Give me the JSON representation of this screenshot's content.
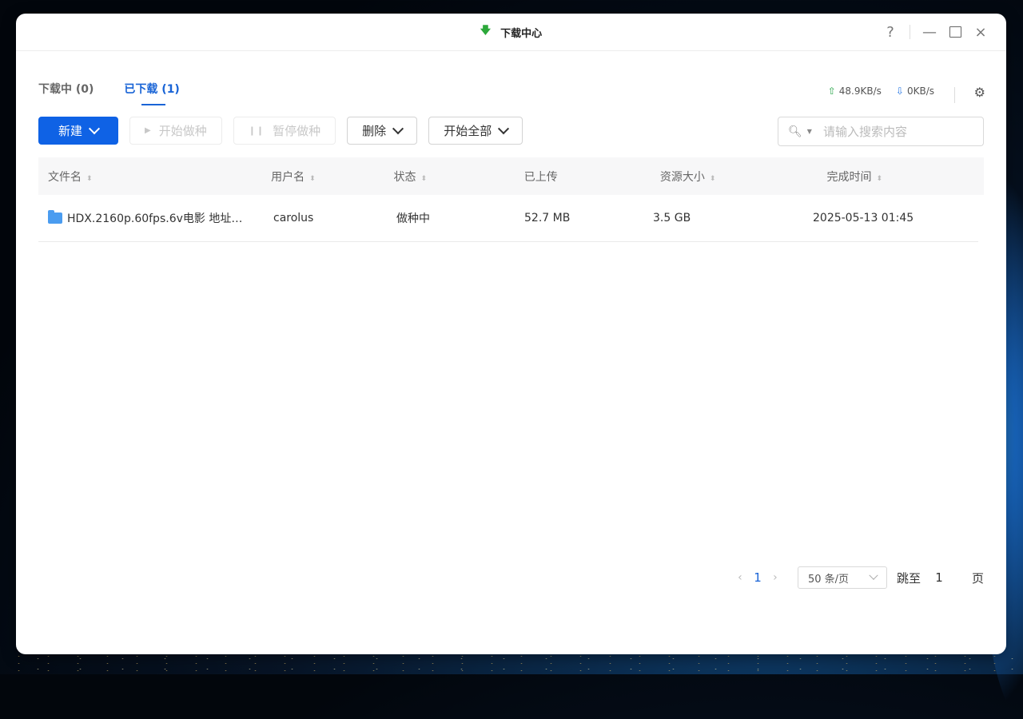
{
  "window": {
    "title": "下载中心",
    "help": "?",
    "minimize": "—",
    "close": "×"
  },
  "tabs": [
    {
      "label": "下载中 (0)",
      "active": false
    },
    {
      "label": "已下载 (1)",
      "active": true
    }
  ],
  "speed": {
    "upload": "48.9KB/s",
    "download": "0KB/s"
  },
  "toolbar": {
    "new_label": "新建",
    "start_seed_label": "开始做种",
    "pause_seed_label": "暂停做种",
    "delete_label": "删除",
    "start_all_label": "开始全部"
  },
  "search": {
    "placeholder": "请输入搜索内容"
  },
  "table": {
    "columns": [
      "文件名",
      "用户名",
      "状态",
      "已上传",
      "资源大小",
      "完成时间"
    ],
    "rows": [
      {
        "filename": "HDX.2160p.60fps.6v电影 地址…",
        "user": "carolus",
        "status": "做种中",
        "uploaded": "52.7 MB",
        "size": "3.5 GB",
        "completed": "2025-05-13 01:45"
      }
    ]
  },
  "pagination": {
    "current_page": "1",
    "page_size": "50 条/页",
    "jump_label": "跳至",
    "jump_value": "1",
    "page_suffix": "页"
  },
  "colors": {
    "accent": "#0f62e5",
    "active_tab": "#1964d6",
    "upload_green": "#2fa84f"
  }
}
